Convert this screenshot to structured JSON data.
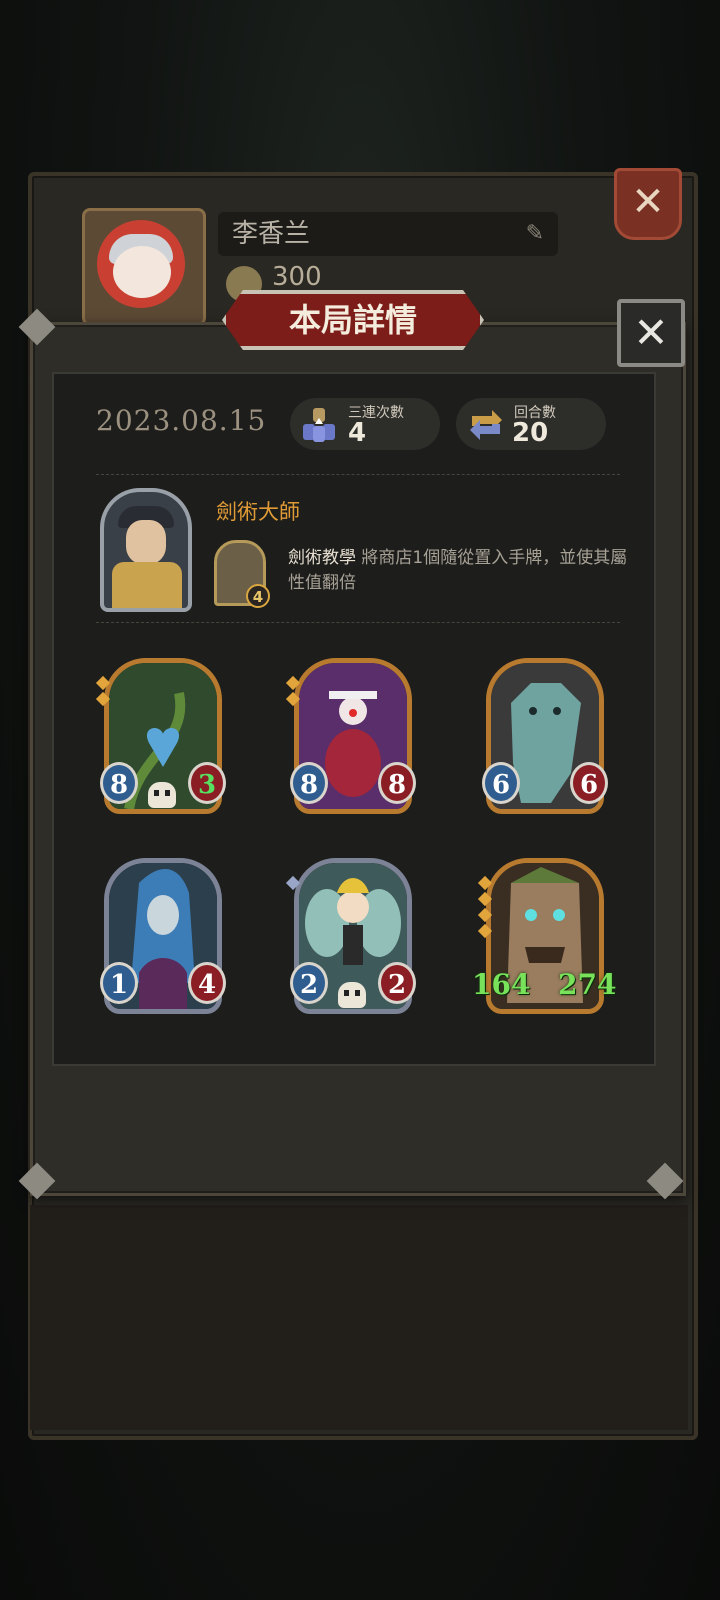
{
  "background_profile": {
    "player_name": "李香兰",
    "coins": "300",
    "close_label": "✕",
    "edit_icon": "pencil-icon"
  },
  "dialog": {
    "title": "本局詳情",
    "close_label": "✕"
  },
  "match": {
    "date": "2023.08.15",
    "triples": {
      "label": "三連次數",
      "value": "4",
      "icon": "triple-merge-icon"
    },
    "rounds": {
      "label": "回合數",
      "value": "20",
      "icon": "cycle-arrows-icon"
    }
  },
  "hero": {
    "name": "劍術大師",
    "skill_name": "劍術教學",
    "skill_description": "將商店1個隨從置入手牌，並使其屬性值翻倍",
    "skill_level": "4"
  },
  "cards": [
    {
      "atk": "8",
      "hp": "3",
      "hp_buffed": true,
      "stars": 2,
      "frame": "gold",
      "deathrattle": true,
      "art": "vine-heart"
    },
    {
      "atk": "8",
      "hp": "8",
      "hp_buffed": false,
      "stars": 2,
      "frame": "gold",
      "deathrattle": false,
      "art": "jester"
    },
    {
      "atk": "6",
      "hp": "6",
      "hp_buffed": false,
      "stars": 0,
      "frame": "gold",
      "deathrattle": false,
      "art": "stone-beast"
    },
    {
      "atk": "1",
      "hp": "4",
      "hp_buffed": false,
      "stars": 0,
      "frame": "silver",
      "deathrattle": false,
      "art": "sorceress"
    },
    {
      "atk": "2",
      "hp": "2",
      "hp_buffed": false,
      "stars": 1,
      "frame": "silver",
      "deathrattle": true,
      "art": "fairy"
    },
    {
      "atk": "164",
      "hp": "274",
      "hp_buffed": true,
      "stars": 4,
      "frame": "gold",
      "deathrattle": false,
      "art": "treant",
      "large_stats": true
    }
  ],
  "colors": {
    "accent_gold": "#e09a36",
    "banner_red": "#7c1d1a",
    "buff_green": "#77e25a"
  }
}
